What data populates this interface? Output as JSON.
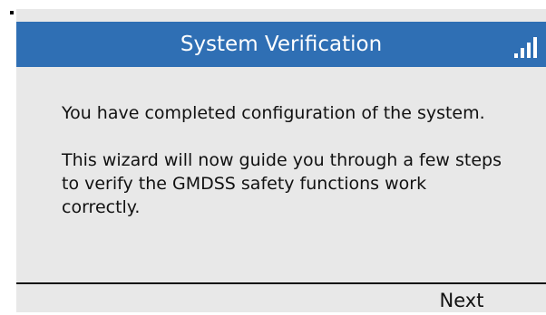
{
  "header": {
    "title": "System Verification",
    "signal_icon": "signal-strength-icon",
    "background_color": "#2f6fb4"
  },
  "content": {
    "paragraph_1": "You have completed configuration of the system.",
    "paragraph_2": "This wizard will now guide you through a few steps to verify the GMDSS safety functions work correctly."
  },
  "footer": {
    "next_label": "Next"
  }
}
